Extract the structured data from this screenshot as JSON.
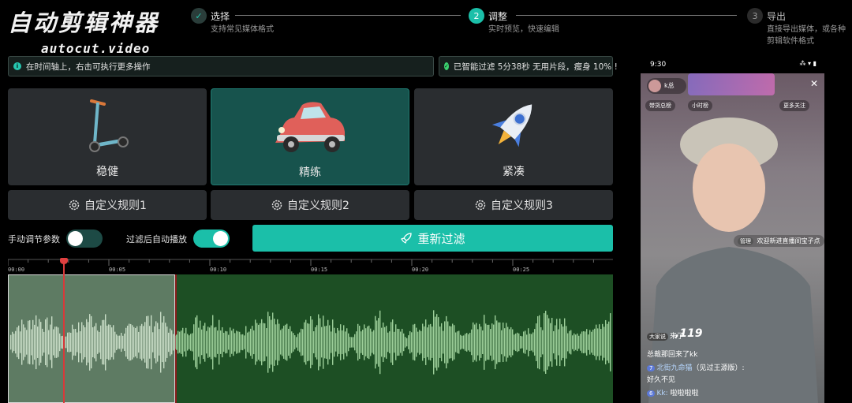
{
  "app": {
    "logo_title": "自动剪辑神器",
    "logo_subtitle": "autocut.video"
  },
  "steps": [
    {
      "number": "✓",
      "title": "选择",
      "desc": "支持常见媒体格式"
    },
    {
      "number": "2",
      "title": "调整",
      "desc": "实时预览，快速编辑"
    },
    {
      "number": "3",
      "title": "导出",
      "desc": "直接导出媒体，或各种",
      "desc2": "剪辑软件格式"
    }
  ],
  "notices": {
    "info": "在时间轴上，右击可执行更多操作",
    "success": "已智能过滤 5分38秒 无用片段，瘦身 10% !"
  },
  "modes": [
    {
      "label": "稳健",
      "icon": "scooter-icon",
      "active": false
    },
    {
      "label": "精练",
      "icon": "car-icon",
      "active": true
    },
    {
      "label": "紧凑",
      "icon": "rocket-icon",
      "active": false
    }
  ],
  "custom_rules": [
    "自定义规则1",
    "自定义规则2",
    "自定义规则3"
  ],
  "toggles": {
    "manual_params": {
      "label": "手动调节参数",
      "on": false
    },
    "autoplay_after_filter": {
      "label": "过滤后自动播放",
      "on": true
    }
  },
  "refilter_button": "重新过滤",
  "timeline": {
    "ticks": [
      "00:00",
      "00:05",
      "00:10",
      "00:15",
      "00:20",
      "00:25"
    ]
  },
  "colors": {
    "accent": "#1bbfa9",
    "active_card": "#17534d",
    "waveform_bg": "#1d4f24",
    "playhead": "#d93a3a"
  },
  "preview": {
    "status_time": "9:30",
    "status_right": "⁂ ▾ ▮",
    "host_name": "k总",
    "pills": [
      "带货总榜",
      "小时榜",
      "更多关注"
    ],
    "banner_text": "直播中",
    "welcome": "欢迎新进直播间宝子点",
    "overlay_num": ",119",
    "chat": [
      {
        "lvl": "大家说",
        "user": "",
        "text": "来了"
      },
      {
        "lvl": "",
        "user": "",
        "text": "总裁那回来了kk"
      },
      {
        "lvl": "7",
        "user": "北街九命猫",
        "text": "（见过王源版）:"
      },
      {
        "lvl": "",
        "user": "",
        "text": "好久不见"
      },
      {
        "lvl": "6",
        "user": "Kk:",
        "text": "啦啦啦啦"
      }
    ],
    "badge_admin": "管理"
  }
}
